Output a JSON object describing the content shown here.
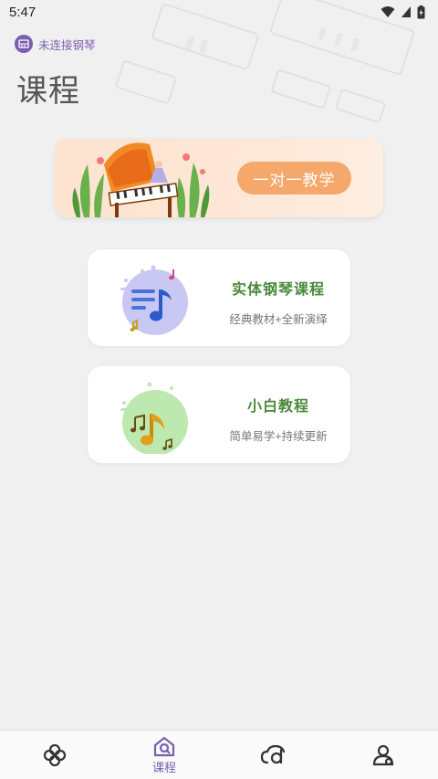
{
  "status_bar": {
    "time": "5:47",
    "icons": [
      "wifi-icon",
      "signal-icon",
      "battery-icon"
    ]
  },
  "piano_connection": {
    "text": "未连接钢琴",
    "icon": "piano-icon",
    "color": "#7a5fb0"
  },
  "page": {
    "title": "课程"
  },
  "banner": {
    "button_label": "一对一教学",
    "accent": "#f5a86c"
  },
  "courses": [
    {
      "title": "实体钢琴课程",
      "subtitle": "经典教材+全新演绎",
      "icon": "music-note-list-icon",
      "accent": "#c9c8f5"
    },
    {
      "title": "小白教程",
      "subtitle": "简单易学+持续更新",
      "icon": "music-notes-icon",
      "accent": "#bde8b0"
    }
  ],
  "bottom_nav": {
    "items": [
      {
        "icon": "flower-icon",
        "label": ""
      },
      {
        "icon": "course-house-icon",
        "label": "课程",
        "active": true
      },
      {
        "icon": "cloud-d-icon",
        "label": ""
      },
      {
        "icon": "profile-icon",
        "label": ""
      }
    ],
    "active_color": "#7a5fb0"
  }
}
